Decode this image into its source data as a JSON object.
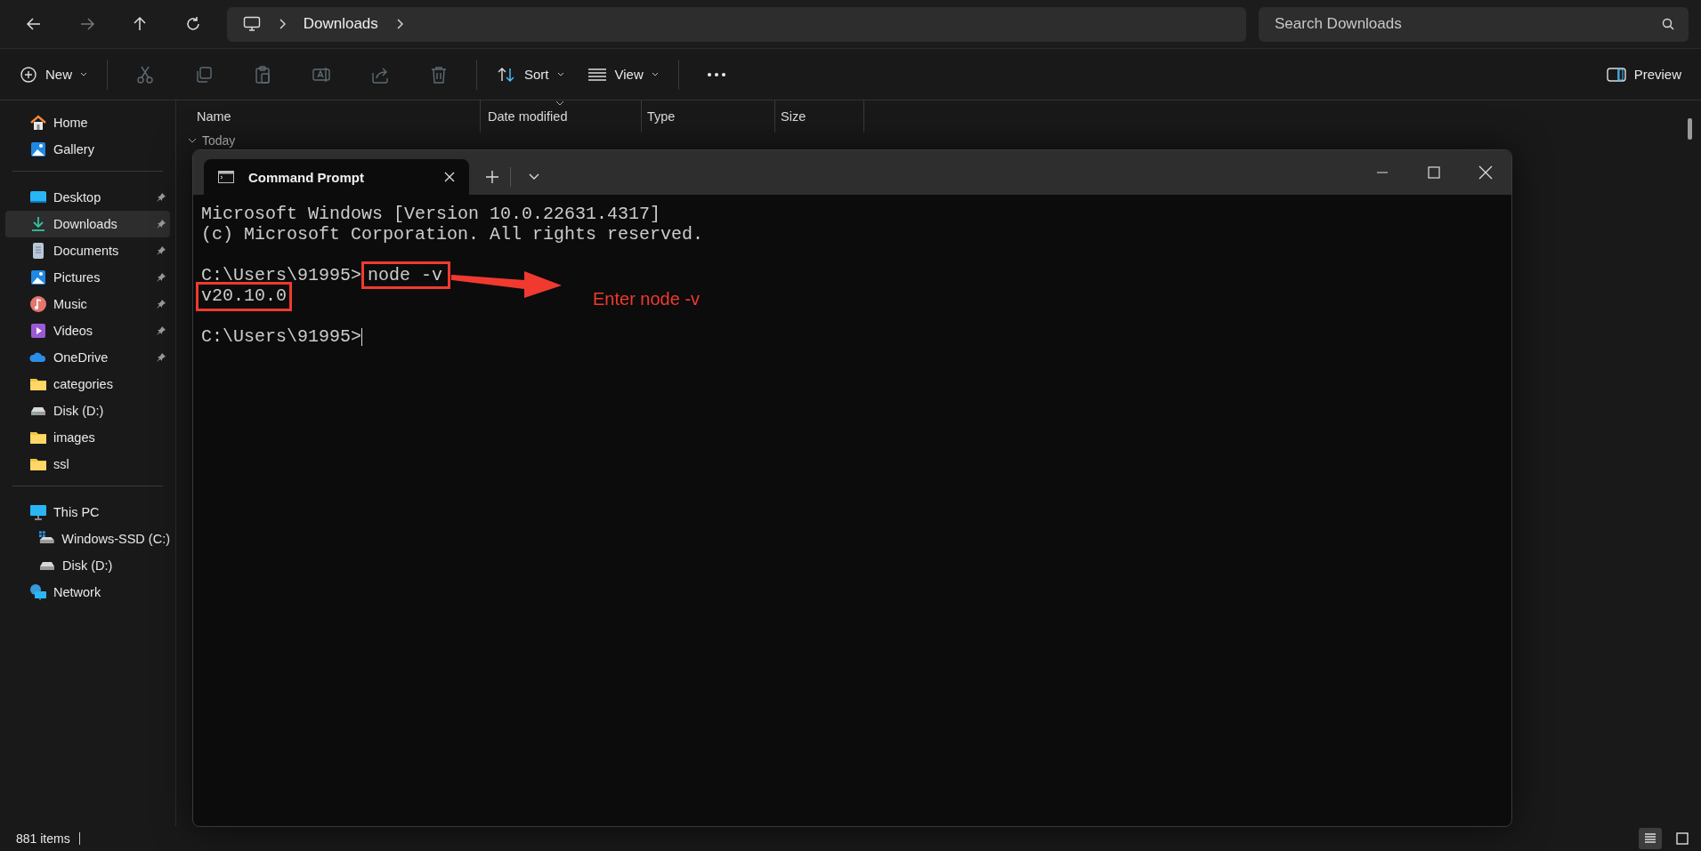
{
  "address": {
    "crumbs": [
      "Downloads"
    ]
  },
  "search": {
    "placeholder": "Search Downloads"
  },
  "toolbar": {
    "new_label": "New",
    "actions": [
      {
        "kind": "cut",
        "disabled": true
      },
      {
        "kind": "copy",
        "disabled": true
      },
      {
        "kind": "paste",
        "disabled": true
      },
      {
        "kind": "rename",
        "disabled": true
      },
      {
        "kind": "share",
        "disabled": true
      },
      {
        "kind": "delete",
        "disabled": true
      }
    ],
    "sort_label": "Sort",
    "view_label": "View",
    "preview_label": "Preview"
  },
  "sidebar": {
    "groups": [
      [
        {
          "label": "Home",
          "kind": "home",
          "pinned": false,
          "selected": false
        },
        {
          "label": "Gallery",
          "kind": "gallery",
          "pinned": false,
          "selected": false
        }
      ],
      [
        {
          "label": "Desktop",
          "kind": "desktop",
          "pinned": true,
          "selected": false
        },
        {
          "label": "Downloads",
          "kind": "downloads",
          "pinned": true,
          "selected": true
        },
        {
          "label": "Documents",
          "kind": "documents",
          "pinned": true,
          "selected": false
        },
        {
          "label": "Pictures",
          "kind": "gallery",
          "pinned": true,
          "selected": false
        },
        {
          "label": "Music",
          "kind": "music",
          "pinned": true,
          "selected": false
        },
        {
          "label": "Videos",
          "kind": "videos",
          "pinned": true,
          "selected": false
        },
        {
          "label": "OneDrive",
          "kind": "cloud",
          "pinned": true,
          "selected": false
        },
        {
          "label": "categories",
          "kind": "folder",
          "pinned": false,
          "selected": false
        },
        {
          "label": "Disk (D:)",
          "kind": "drive",
          "pinned": false,
          "selected": false
        },
        {
          "label": "images",
          "kind": "folder",
          "pinned": false,
          "selected": false
        },
        {
          "label": "ssl",
          "kind": "folder",
          "pinned": false,
          "selected": false
        }
      ],
      [
        {
          "label": "This PC",
          "kind": "pc",
          "pinned": false,
          "selected": false,
          "children": [
            {
              "label": "Windows-SSD (C:)",
              "kind": "system-drive",
              "selected": false
            },
            {
              "label": "Disk (D:)",
              "kind": "drive",
              "selected": false
            }
          ]
        },
        {
          "label": "Network",
          "kind": "network",
          "pinned": false,
          "selected": false
        }
      ]
    ]
  },
  "columns": [
    {
      "label": "Name",
      "sorted": false
    },
    {
      "label": "Date modified",
      "sorted": true
    },
    {
      "label": "Type",
      "sorted": false
    },
    {
      "label": "Size",
      "sorted": false
    }
  ],
  "group_header": "Today",
  "status_bar": {
    "count": "881 items",
    "views": [
      {
        "kind": "details",
        "selected": true
      },
      {
        "kind": "tiles",
        "selected": false
      }
    ]
  },
  "terminal": {
    "tab_title": "Command Prompt",
    "lines": [
      {
        "kind": "output",
        "text": "Microsoft Windows [Version 10.0.22631.4317]"
      },
      {
        "kind": "output",
        "text": "(c) Microsoft Corporation. All rights reserved."
      },
      {
        "kind": "blank"
      },
      {
        "kind": "command",
        "prompt": "C:\\Users\\91995>",
        "command": "node -v",
        "highlighted": true
      },
      {
        "kind": "output",
        "text": "v20.10.0",
        "highlighted": true
      },
      {
        "kind": "blank"
      },
      {
        "kind": "prompt",
        "prompt": "C:\\Users\\91995>"
      }
    ],
    "annotation": "Enter node -v"
  }
}
